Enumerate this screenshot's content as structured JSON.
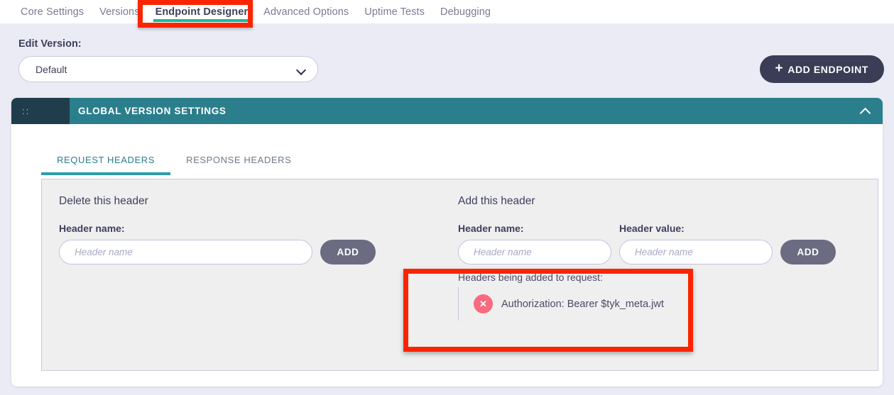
{
  "top_tabs": [
    {
      "label": "Core Settings",
      "active": false
    },
    {
      "label": "Versions",
      "active": false
    },
    {
      "label": "Endpoint Designer",
      "active": true
    },
    {
      "label": "Advanced Options",
      "active": false
    },
    {
      "label": "Uptime Tests",
      "active": false
    },
    {
      "label": "Debugging",
      "active": false
    }
  ],
  "version": {
    "label": "Edit Version:",
    "selected": "Default",
    "chevron_icon": "chevron-down-icon"
  },
  "add_endpoint": {
    "label": "ADD ENDPOINT",
    "plus_icon": "plus-icon"
  },
  "panel": {
    "drag_handle_glyph": "::",
    "title": "GLOBAL VERSION SETTINGS",
    "collapse_icon": "chevron-up-icon",
    "header_bg": "#2b7f8c",
    "handle_bg": "#1f3d4b"
  },
  "subtabs": [
    {
      "label": "REQUEST HEADERS",
      "active": true
    },
    {
      "label": "RESPONSE HEADERS",
      "active": false
    }
  ],
  "delete_header": {
    "section_title": "Delete this header",
    "name_label": "Header name:",
    "name_value": "",
    "name_placeholder": "Header name",
    "add_label": "ADD"
  },
  "add_header": {
    "section_title": "Add this header",
    "name_label": "Header name:",
    "name_value": "",
    "name_placeholder": "Header name",
    "value_label": "Header value:",
    "value_value": "",
    "value_placeholder": "Header name",
    "add_label": "ADD"
  },
  "headers_added": {
    "title": "Headers being added to request:",
    "items": [
      {
        "text": "Authorization: Bearer $tyk_meta.jwt",
        "delete_glyph": "✕"
      }
    ]
  },
  "colors": {
    "page_bg": "#ebebf5",
    "accent_teal": "#2b7f8c",
    "active_tab_underline": "#16bba0",
    "annotation_red": "#fa2500",
    "delete_pink": "#fa6b7e",
    "dark_button": "#3b3c55",
    "add_button": "#6b6b82"
  }
}
